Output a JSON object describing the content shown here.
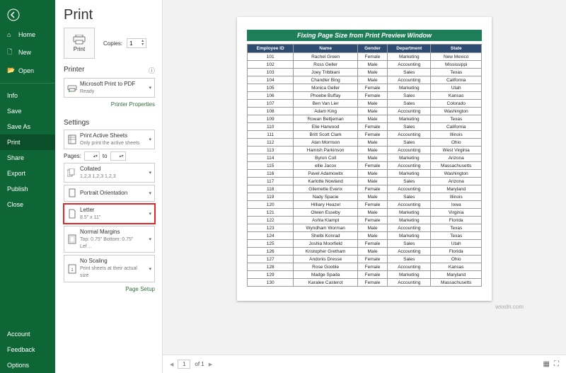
{
  "sidebar": {
    "items": [
      {
        "icon": "home",
        "label": "Home"
      },
      {
        "icon": "new",
        "label": "New"
      },
      {
        "icon": "open",
        "label": "Open"
      }
    ],
    "items2": [
      {
        "label": "Info"
      },
      {
        "label": "Save"
      },
      {
        "label": "Save As"
      },
      {
        "label": "Print",
        "active": true
      },
      {
        "label": "Share"
      },
      {
        "label": "Export"
      },
      {
        "label": "Publish"
      },
      {
        "label": "Close"
      }
    ],
    "bottom": [
      {
        "label": "Account"
      },
      {
        "label": "Feedback"
      },
      {
        "label": "Options"
      }
    ]
  },
  "panel": {
    "title": "Print",
    "printBtn": "Print",
    "copiesLbl": "Copies:",
    "copiesVal": "1",
    "printerHdr": "Printer",
    "printerName": "Microsoft Print to PDF",
    "printerStatus": "Ready",
    "printerProps": "Printer Properties",
    "settingsHdr": "Settings",
    "activeSheets": {
      "t": "Print Active Sheets",
      "s": "Only print the active sheets"
    },
    "pagesLbl": "Pages:",
    "pagesTo": "to",
    "collated": {
      "t": "Collated",
      "s": "1,2,3   1,2,3   1,2,3"
    },
    "orient": {
      "t": "Portrait Orientation",
      "s": ""
    },
    "paper": {
      "t": "Letter",
      "s": "8.5\" x 11\""
    },
    "margins": {
      "t": "Normal Margins",
      "s": "Top: 0.75\" Bottom: 0.75\" Lef…"
    },
    "scaling": {
      "t": "No Scaling",
      "s": "Print sheets at their actual size"
    },
    "pageSetup": "Page Setup"
  },
  "preview": {
    "title": "Fixing Page Size from Print Preview Window",
    "headers": [
      "Employee ID",
      "Name",
      "Gender",
      "Department",
      "State"
    ],
    "rows": [
      [
        "101",
        "Rachel Green",
        "Female",
        "Marketing",
        "New Mexico"
      ],
      [
        "102",
        "Ross Geller",
        "Male",
        "Accounting",
        "Mississippi"
      ],
      [
        "103",
        "Joey Tribbiani",
        "Male",
        "Sales",
        "Texas"
      ],
      [
        "104",
        "Chandler Bing",
        "Male",
        "Accounting",
        "California"
      ],
      [
        "105",
        "Monica Geller",
        "Female",
        "Marketing",
        "Utah"
      ],
      [
        "106",
        "Phoebe Buffay",
        "Female",
        "Sales",
        "Kansas"
      ],
      [
        "107",
        "Ben Van Lier",
        "Male",
        "Sales",
        "Colorado"
      ],
      [
        "108",
        "Adam King",
        "Male",
        "Accounting",
        "Washington"
      ],
      [
        "109",
        "Rowan Bettjeman",
        "Male",
        "Marketing",
        "Texas"
      ],
      [
        "110",
        "Elie Harwood",
        "Female",
        "Sales",
        "California"
      ],
      [
        "111",
        "Britt Scott Clark",
        "Female",
        "Accounting",
        "Illinois"
      ],
      [
        "112",
        "Alan Morrison",
        "Male",
        "Sales",
        "Ohio"
      ],
      [
        "113",
        "Hamish Parkinson",
        "Male",
        "Accounting",
        "West Virginia"
      ],
      [
        "114",
        "Byron Coll",
        "Male",
        "Marketing",
        "Arizona"
      ],
      [
        "115",
        "ellie Jacox",
        "Female",
        "Accounting",
        "Massachusetts"
      ],
      [
        "116",
        "Pavel Adamowitx",
        "Male",
        "Marketing",
        "Washington"
      ],
      [
        "117",
        "Karlotte Nowland",
        "Male",
        "Sales",
        "Arizona"
      ],
      [
        "118",
        "Gilemette Everix",
        "Female",
        "Accounting",
        "Maryland"
      ],
      [
        "119",
        "Nady Spacie",
        "Male",
        "Sales",
        "Illinois"
      ],
      [
        "120",
        "Hilliary Heazel",
        "Female",
        "Accounting",
        "Iowa"
      ],
      [
        "121",
        "Olwen Esseby",
        "Male",
        "Marketing",
        "Virginia"
      ],
      [
        "122",
        "Ashla Klampt",
        "Female",
        "Marketing",
        "Florida"
      ],
      [
        "123",
        "Wyndham Worman",
        "Male",
        "Accounting",
        "Texas"
      ],
      [
        "124",
        "Shelbi Konrad",
        "Male",
        "Marketing",
        "Texas"
      ],
      [
        "125",
        "Joshia Moorfield",
        "Female",
        "Sales",
        "Utah"
      ],
      [
        "126",
        "Kristopher Gretham",
        "Male",
        "Accounting",
        "Florida"
      ],
      [
        "127",
        "Andonis Dresse",
        "Female",
        "Sales",
        "Ohio"
      ],
      [
        "128",
        "Rose Gooble",
        "Female",
        "Accounting",
        "Kansas"
      ],
      [
        "129",
        "Madge Spada",
        "Female",
        "Marketing",
        "Maryland"
      ],
      [
        "130",
        "Karalee Casterot",
        "Female",
        "Accounting",
        "Massachusetts"
      ]
    ]
  },
  "pager": {
    "current": "1",
    "total": "of 1"
  },
  "watermark": "wsxdn.com"
}
